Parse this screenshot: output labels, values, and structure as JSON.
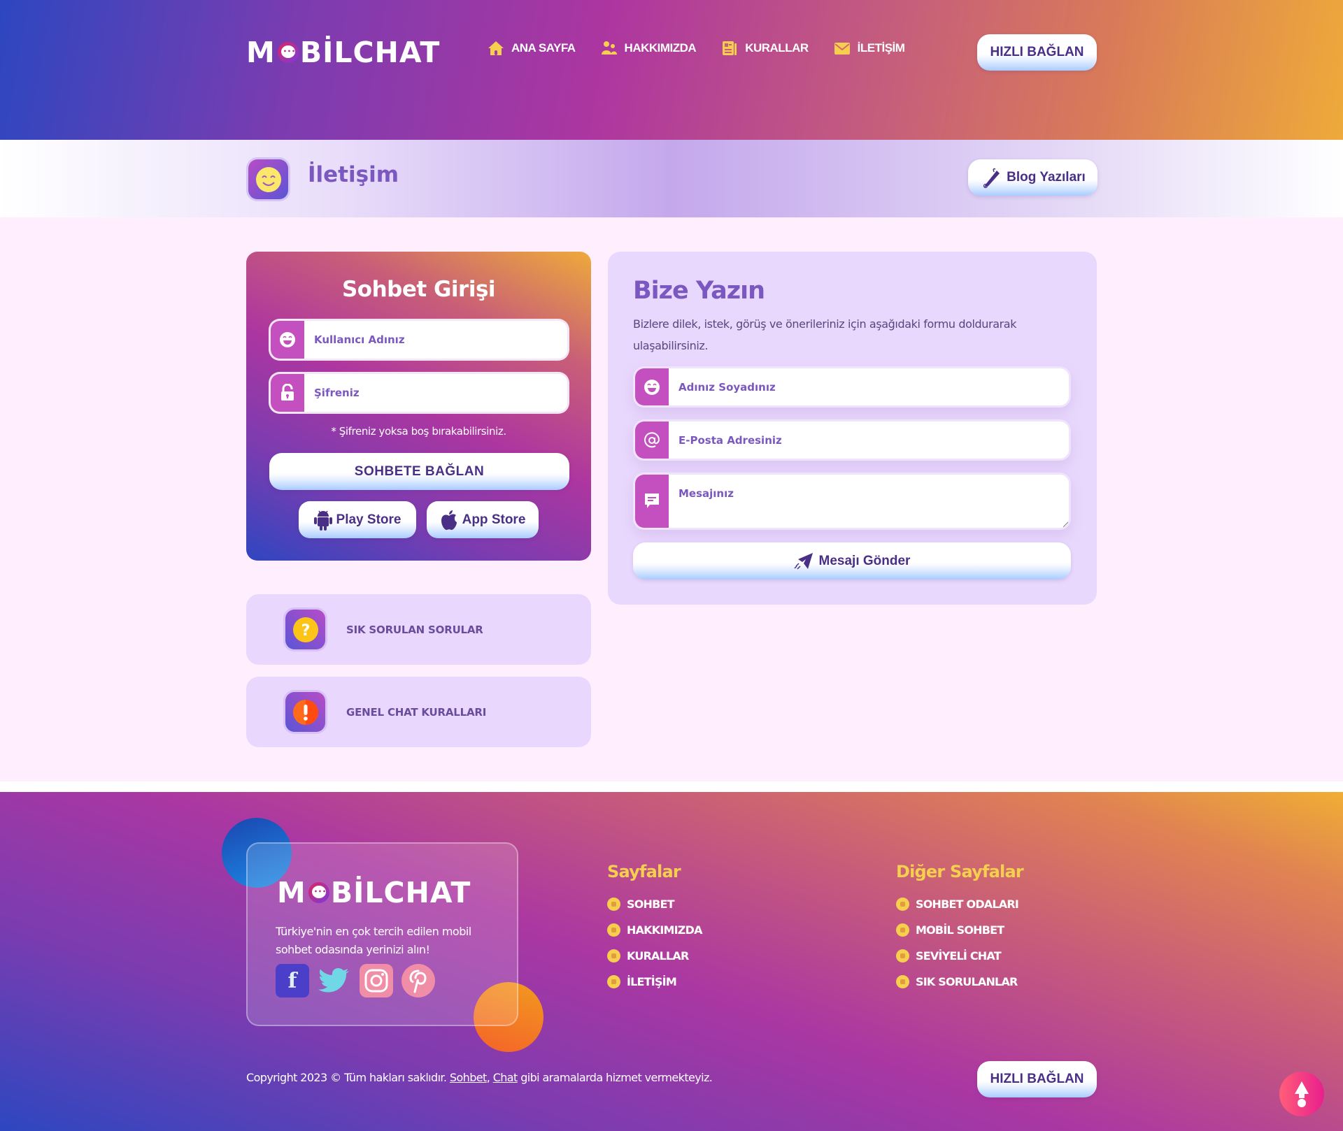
{
  "brand": {
    "logo_before": "M",
    "logo_after": "BİLCHAT"
  },
  "header": {
    "nav": [
      {
        "label": "ANA SAYFA",
        "icon": "home-icon"
      },
      {
        "label": "HAKKIMIZDA",
        "icon": "users-icon"
      },
      {
        "label": "KURALLAR",
        "icon": "newspaper-icon"
      },
      {
        "label": "İLETİŞİM",
        "icon": "envelope-icon"
      }
    ],
    "cta_label": "HIZLI BAĞLAN"
  },
  "titlebar": {
    "title": "İletişim",
    "icon": "smile-icon",
    "blog_button": "Blog Yazıları"
  },
  "login": {
    "title": "Sohbet Girişi",
    "username_placeholder": "Kullanıcı Adınız",
    "password_placeholder": "Şifreniz",
    "note": "* Şifreniz yoksa boş bırakabilirsiniz.",
    "connect_button": "SOHBETE BAĞLAN",
    "play_store": "Play Store",
    "app_store": "App Store"
  },
  "info_cards": [
    {
      "label": "SIK SORULAN SORULAR",
      "icon": "question-icon"
    },
    {
      "label": "GENEL CHAT KURALLARI",
      "icon": "exclamation-icon"
    }
  ],
  "contact": {
    "title": "Bize Yazın",
    "description": "Bizlere dilek, istek, görüş ve önerileriniz için aşağıdaki formu doldurarak ulaşabilirsiniz.",
    "name_placeholder": "Adınız Soyadınız",
    "email_placeholder": "E-Posta Adresiniz",
    "message_placeholder": "Mesajınız",
    "send_button": "Mesajı Gönder"
  },
  "footer": {
    "description": "Türkiye'nin en çok tercih edilen mobil sohbet odasında yerinizi alın!",
    "socials": [
      "facebook",
      "twitter",
      "instagram",
      "pinterest"
    ],
    "col1_title": "Sayfalar",
    "col1_links": [
      "SOHBET",
      "HAKKIMIZDA",
      "KURALLAR",
      "İLETİŞİM"
    ],
    "col2_title": "Diğer Sayfalar",
    "col2_links": [
      "SOHBET ODALARI",
      "MOBİL SOHBET",
      "SEVİYELİ CHAT",
      "SIK SORULANLAR"
    ],
    "copyright_prefix": "Copyright 2023 © Tüm hakları saklıdır.",
    "link1": "Sohbet",
    "separator": ",",
    "link2": "Chat",
    "copyright_suffix": "gibi aramalarda hizmet vermekteyiz.",
    "cta_label": "HIZLI BAĞLAN"
  },
  "colors": {
    "accent_purple": "#7b57c0",
    "button_text": "#4a2f86",
    "field_icon_bg": "#c44fbf",
    "footer_heading": "#f6cf4e",
    "main_bg": "#ffeefe",
    "card_bg": "#e9d8fd"
  }
}
